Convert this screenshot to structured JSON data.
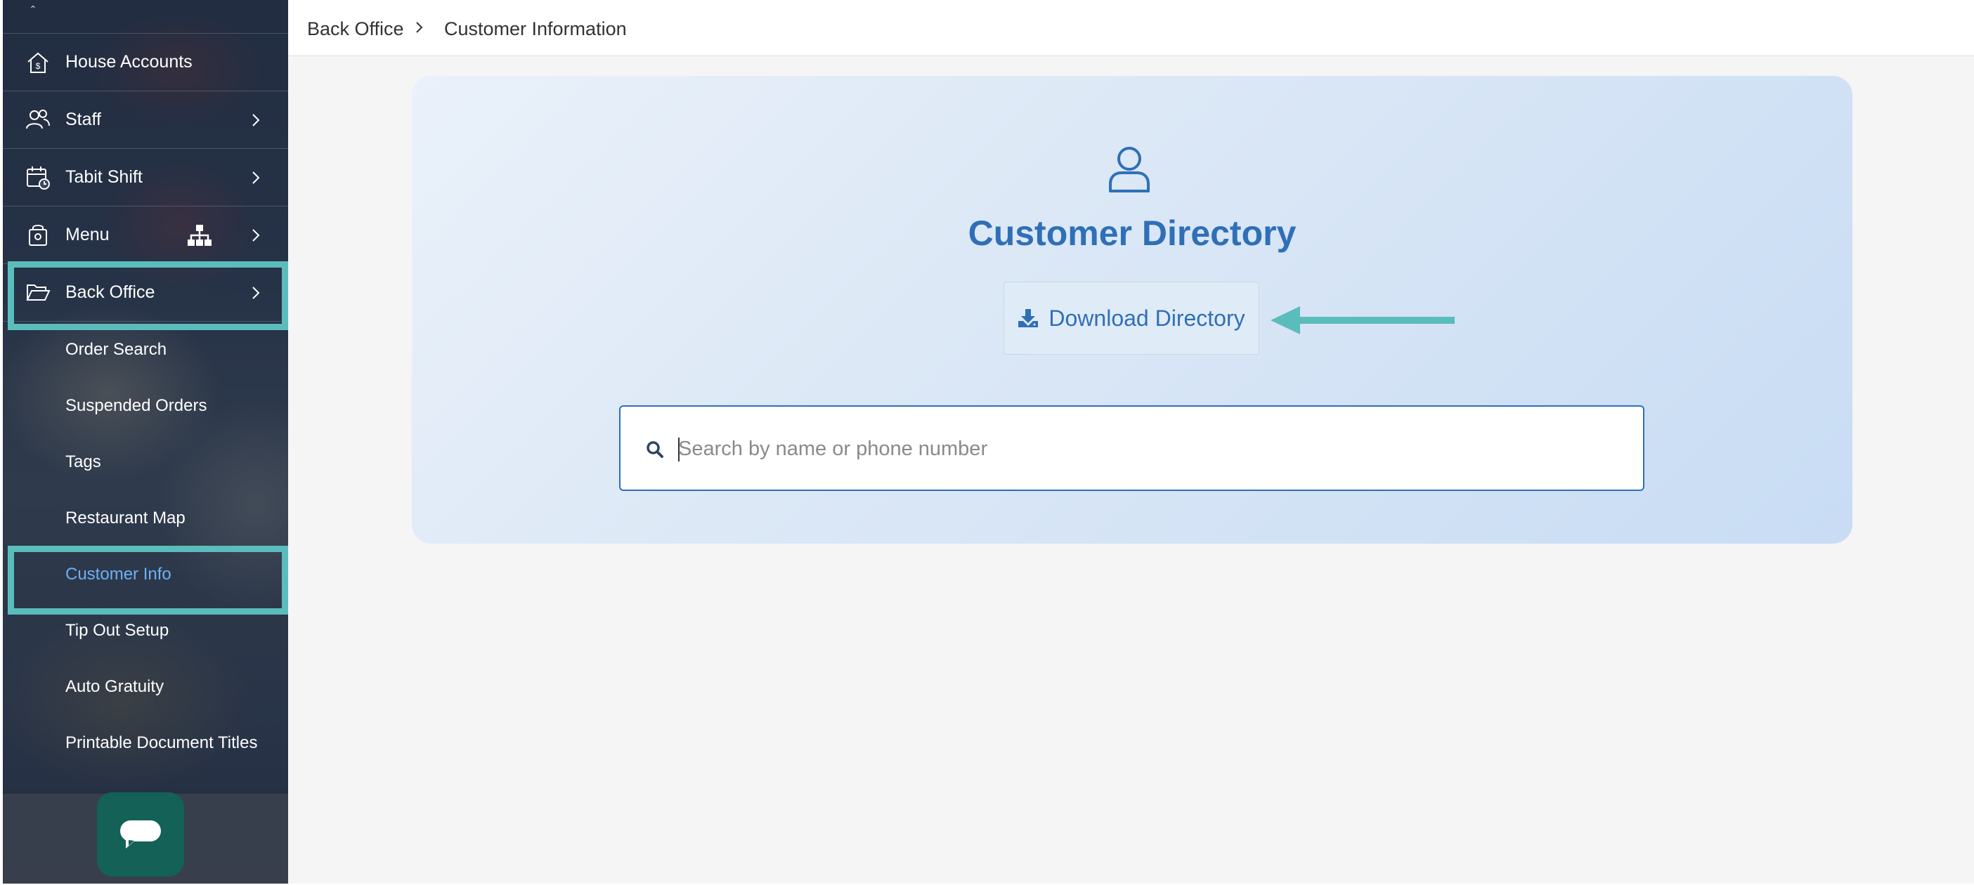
{
  "breadcrumb": {
    "parent": "Back Office",
    "current": "Customer Information"
  },
  "sidebar": {
    "items": [
      {
        "label": "House Accounts",
        "icon": "house-dollar-icon"
      },
      {
        "label": "Staff",
        "icon": "people-icon"
      },
      {
        "label": "Tabit Shift",
        "icon": "calendar-clock-icon"
      },
      {
        "label": "Menu",
        "icon": "menu-bag-icon"
      },
      {
        "label": "Back Office",
        "icon": "folder-open-icon"
      }
    ],
    "sub_items": [
      {
        "label": "Order Search"
      },
      {
        "label": "Suspended Orders"
      },
      {
        "label": "Tags"
      },
      {
        "label": "Restaurant Map"
      },
      {
        "label": "Customer Info",
        "active": true
      },
      {
        "label": "Tip Out Setup"
      },
      {
        "label": "Auto Gratuity"
      },
      {
        "label": "Printable Document Titles"
      }
    ]
  },
  "directory": {
    "title": "Customer Directory",
    "download_label": "Download Directory",
    "search_placeholder": "Search by name or phone number",
    "search_value": ""
  },
  "colors": {
    "accent": "#2f6fb7",
    "highlight": "#5bbcbc",
    "active_sub_item": "#6fb0f2",
    "chat_button": "#136157"
  }
}
